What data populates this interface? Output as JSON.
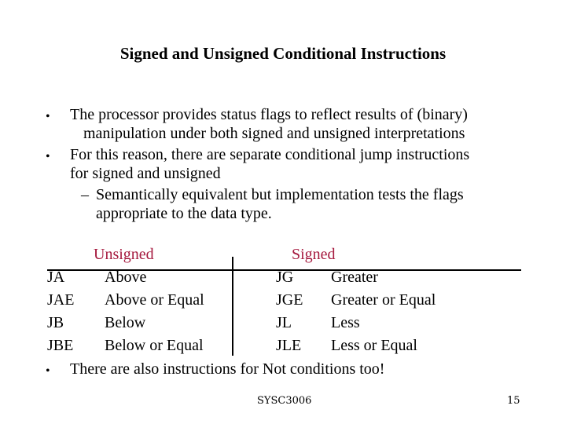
{
  "slide": {
    "title": "Signed and Unsigned Conditional Instructions",
    "bullet_glyph": "•",
    "dash_glyph": "–",
    "bullets": [
      {
        "lines": [
          "The processor provides status flags to reflect results of (binary)",
          "manipulation under both signed and unsigned interpretations"
        ]
      },
      {
        "lines": [
          "For this reason, there are separate conditional jump instructions",
          "for signed and unsigned"
        ],
        "sub": {
          "lines": [
            "Semantically equivalent but implementation tests the flags",
            "appropriate to the data type."
          ]
        }
      }
    ],
    "table": {
      "header_color": "#a5193e",
      "unsigned_header": "Unsigned",
      "signed_header": "Signed",
      "rows": [
        {
          "u_op": "JA",
          "u_desc": "Above",
          "s_op": "JG",
          "s_desc": "Greater"
        },
        {
          "u_op": "JAE",
          "u_desc": "Above or Equal",
          "s_op": "JGE",
          "s_desc": "Greater or Equal"
        },
        {
          "u_op": "JB",
          "u_desc": "Below",
          "s_op": "JL",
          "s_desc": "Less"
        },
        {
          "u_op": "JBE",
          "u_desc": "Below or Equal",
          "s_op": "JLE",
          "s_desc": "Less or Equal"
        }
      ]
    },
    "final_bullet": "There are also instructions for Not conditions too!",
    "footer": {
      "course": "SYSC3006",
      "page_number": "15"
    }
  }
}
